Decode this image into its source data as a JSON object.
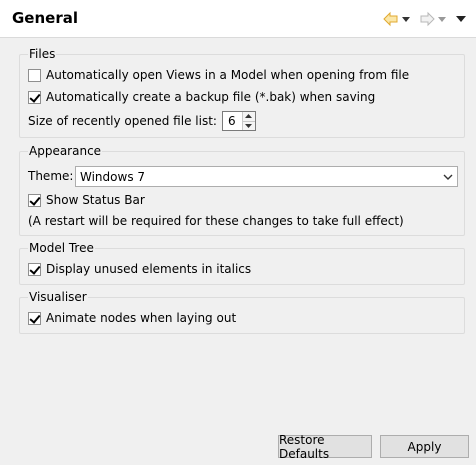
{
  "header": {
    "title": "General",
    "nav_icons": [
      "back-arrow-icon",
      "chevron-down-icon",
      "forward-arrow-icon",
      "chevron-down-icon",
      "view-menu-icon"
    ]
  },
  "files": {
    "label": "Files",
    "open_views_label": "Automatically open Views in a Model when opening from file",
    "open_views_checked": false,
    "backup_label": "Automatically create a backup file (*.bak) when saving",
    "backup_checked": true,
    "recent_list_label": "Size of recently opened file list:",
    "recent_list_value": "6"
  },
  "appearance": {
    "label": "Appearance",
    "theme_label": "Theme:",
    "theme_value": "Windows 7",
    "status_bar_label": "Show Status Bar",
    "status_bar_checked": true,
    "restart_note": "(A restart will be required for these changes to take full effect)"
  },
  "model_tree": {
    "label": "Model Tree",
    "italics_label": "Display unused elements in italics",
    "italics_checked": true
  },
  "visualiser": {
    "label": "Visualiser",
    "animate_label": "Animate nodes when laying out",
    "animate_checked": true
  },
  "buttons": {
    "restore_defaults": "Restore Defaults",
    "apply": "Apply"
  },
  "colors": {
    "back_arrow": "#e8b74a",
    "forward_arrow": "#c8c8c8"
  }
}
